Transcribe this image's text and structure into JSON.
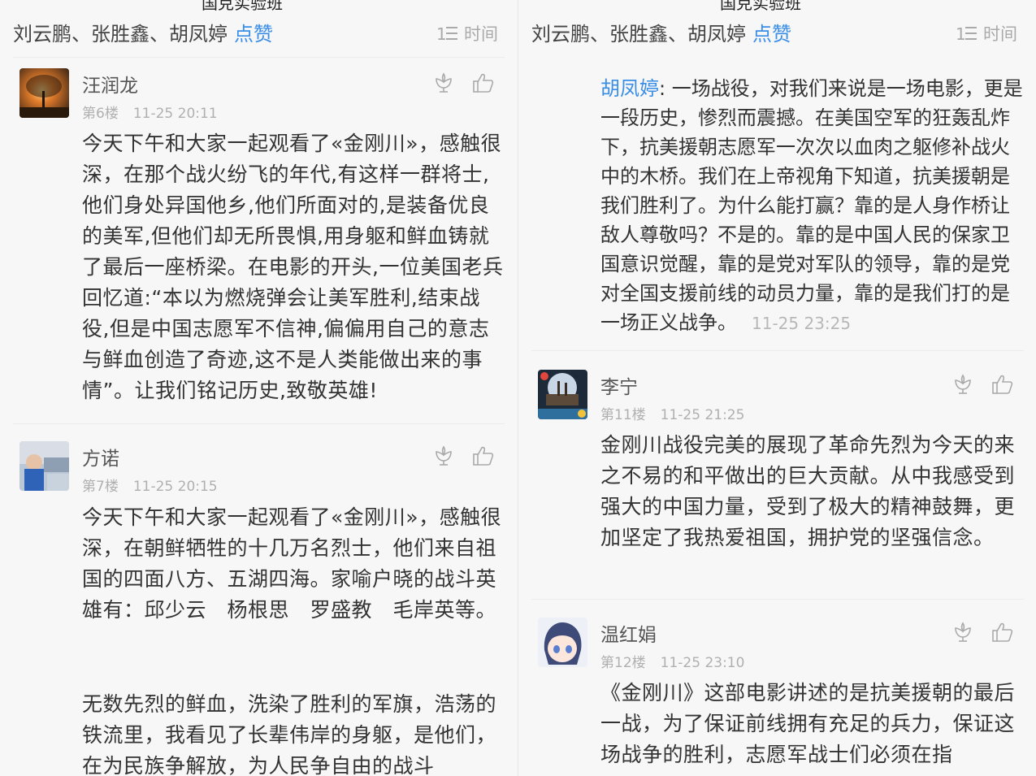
{
  "top_cut_text": "国克实验班",
  "header": {
    "likers": "刘云鹏、张胜鑫、胡凤婷",
    "like_label": "点赞",
    "sort_label": "时间",
    "sort_icon": "sort-lines-icon"
  },
  "left": {
    "comments": [
      {
        "author": "汪润龙",
        "floor": "第6楼",
        "time": "11-25 20:11",
        "text": "今天下午和大家一起观看了«金刚川»，感触很深，在那个战火纷飞的年代,有这样一群将士,他们身处异国他乡,他们所面对的,是装备优良的美军,但他们却无所畏惧,用身躯和鲜血铸就了最后一座桥梁。在电影的开头,一位美国老兵回忆道:“本以为燃烧弹会让美军胜利,结束战役,但是中国志愿军不信神,偏偏用自己的意志与鲜血创造了奇迹,这不是人类能做出来的事情”。让我们铭记历史,致敬英雄!"
      },
      {
        "author": "方诺",
        "floor": "第7楼",
        "time": "11-25 20:15",
        "text": "今天下午和大家一起观看了«金刚川»，感触很深，在朝鲜牺牲的十几万名烈士，他们来自祖国的四面八方、五湖四海。家喻户晓的战斗英雄有：邱少云　杨根思　罗盛教　毛岸英等。",
        "text2": "无数先烈的鲜血，洗染了胜利的军旗，浩荡的铁流里，我看见了长辈伟岸的身躯，是他们，在为民族争解放，为人民争自由的战斗"
      }
    ]
  },
  "right": {
    "reply": {
      "name": "胡凤婷",
      "text": ": 一场战役，对我们来说是一场电影，更是一段历史，惨烈而震撼。在美国空军的狂轰乱炸下，抗美援朝志愿军一次次以血肉之躯修补战火中的木桥。我们在上帝视角下知道，抗美援朝是我们胜利了。为什么能打赢？靠的是人身作桥让敌人尊敬吗？不是的。靠的是中国人民的保家卫国意识觉醒，靠的是党对军队的领导，靠的是党对全国支援前线的动员力量，靠的是我们打的是一场正义战争。",
      "time": "11-25 23:25"
    },
    "comments": [
      {
        "author": "李宁",
        "floor": "第11楼",
        "time": "11-25 21:25",
        "text": "金刚川战役完美的展现了革命先烈为今天的来之不易的和平做出的巨大贡献。从中我感受到强大的中国力量，受到了极大的精神鼓舞，更加坚定了我热爱祖国，拥护党的坚强信念。"
      },
      {
        "author": "温红娟",
        "floor": "第12楼",
        "time": "11-25 23:10",
        "text": "《金刚川》这部电影讲述的是抗美援朝的最后一战，为了保证前线拥有充足的兵力，保证这场战争的胜利，志愿军战士们必须在指"
      }
    ]
  },
  "icons": {
    "flower": "flower-icon",
    "thumb": "thumbs-up-icon"
  }
}
